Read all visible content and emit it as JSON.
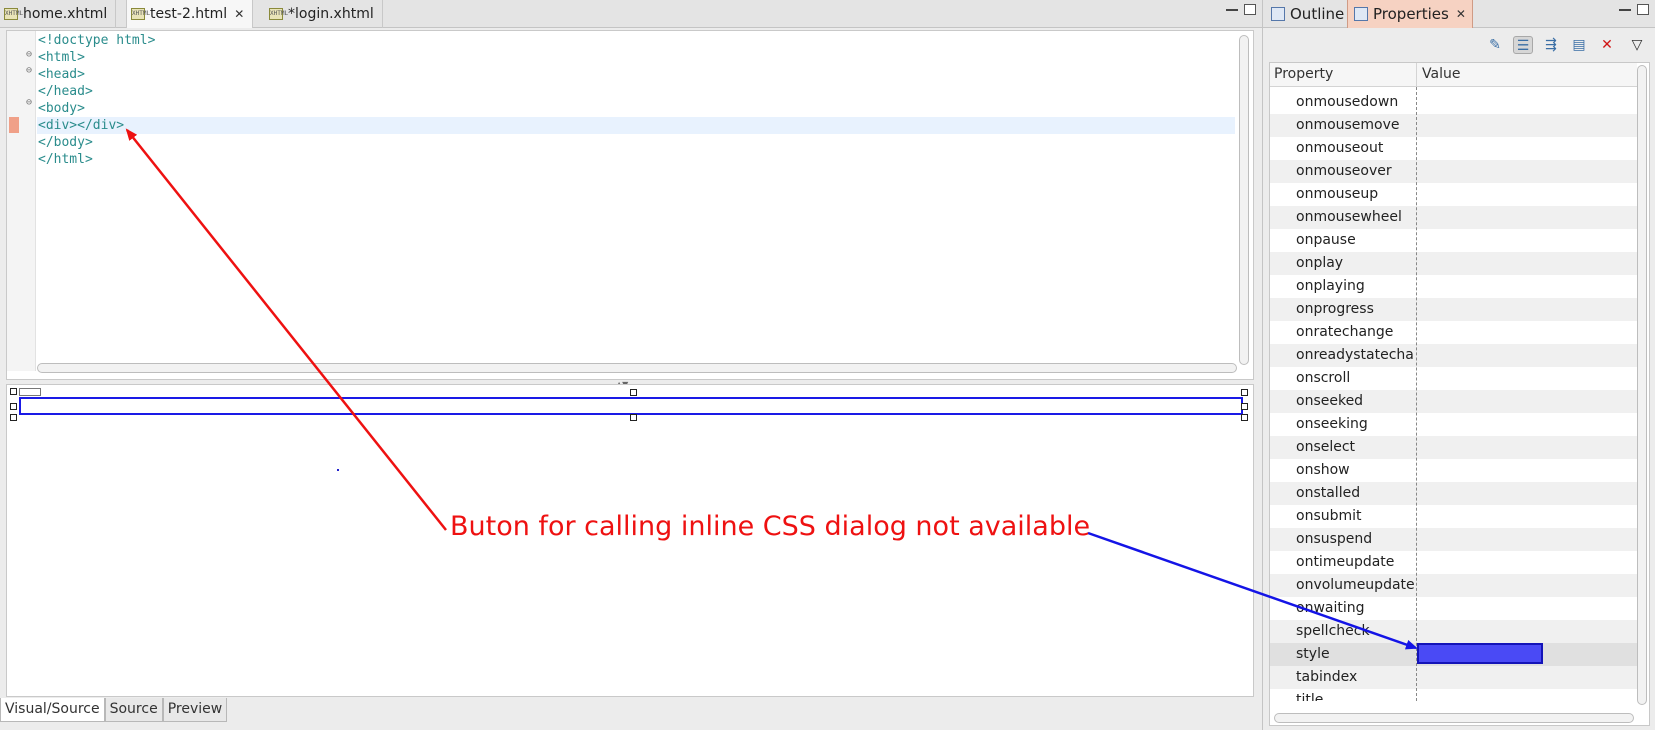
{
  "editor": {
    "tabs": [
      {
        "label": "home.xhtml",
        "active": false
      },
      {
        "label": "test-2.html",
        "active": true
      },
      {
        "label": "*login.xhtml",
        "active": false
      }
    ],
    "file_icon_text": "XHTML",
    "code_lines": [
      "<!doctype html>",
      "<html>",
      "<head>",
      "</head>",
      "<body>",
      "<div></div>",
      "</body>",
      "</html>"
    ],
    "bottom_tabs": [
      {
        "label": "Visual/Source",
        "active": true
      },
      {
        "label": "Source",
        "active": false
      },
      {
        "label": "Preview",
        "active": false
      }
    ]
  },
  "properties": {
    "tabs": [
      {
        "label": "Outline",
        "active": false
      },
      {
        "label": "Properties",
        "active": true
      }
    ],
    "columns": {
      "property": "Property",
      "value": "Value"
    },
    "rows": [
      "onmousedown",
      "onmousemove",
      "onmouseout",
      "onmouseover",
      "onmouseup",
      "onmousewheel",
      "onpause",
      "onplay",
      "onplaying",
      "onprogress",
      "onratechange",
      "onreadystatechange",
      "onscroll",
      "onseeked",
      "onseeking",
      "onselect",
      "onshow",
      "onstalled",
      "onsubmit",
      "onsuspend",
      "ontimeupdate",
      "onvolumeupdate",
      "onwaiting",
      "spellcheck",
      "style",
      "tabindex",
      "title"
    ],
    "selected_row": "style"
  },
  "annotation": {
    "text": "Buton for calling inline CSS dialog not available",
    "color": "#ee1111",
    "arrow_colors": {
      "red": "#ee1111",
      "blue": "#1414e6"
    }
  },
  "colors": {
    "code_text": "#2a8c8c",
    "selection_border": "#1a1ae6",
    "style_value_fill": "#4a4af5",
    "properties_tab_active": "#f6d2c2"
  }
}
